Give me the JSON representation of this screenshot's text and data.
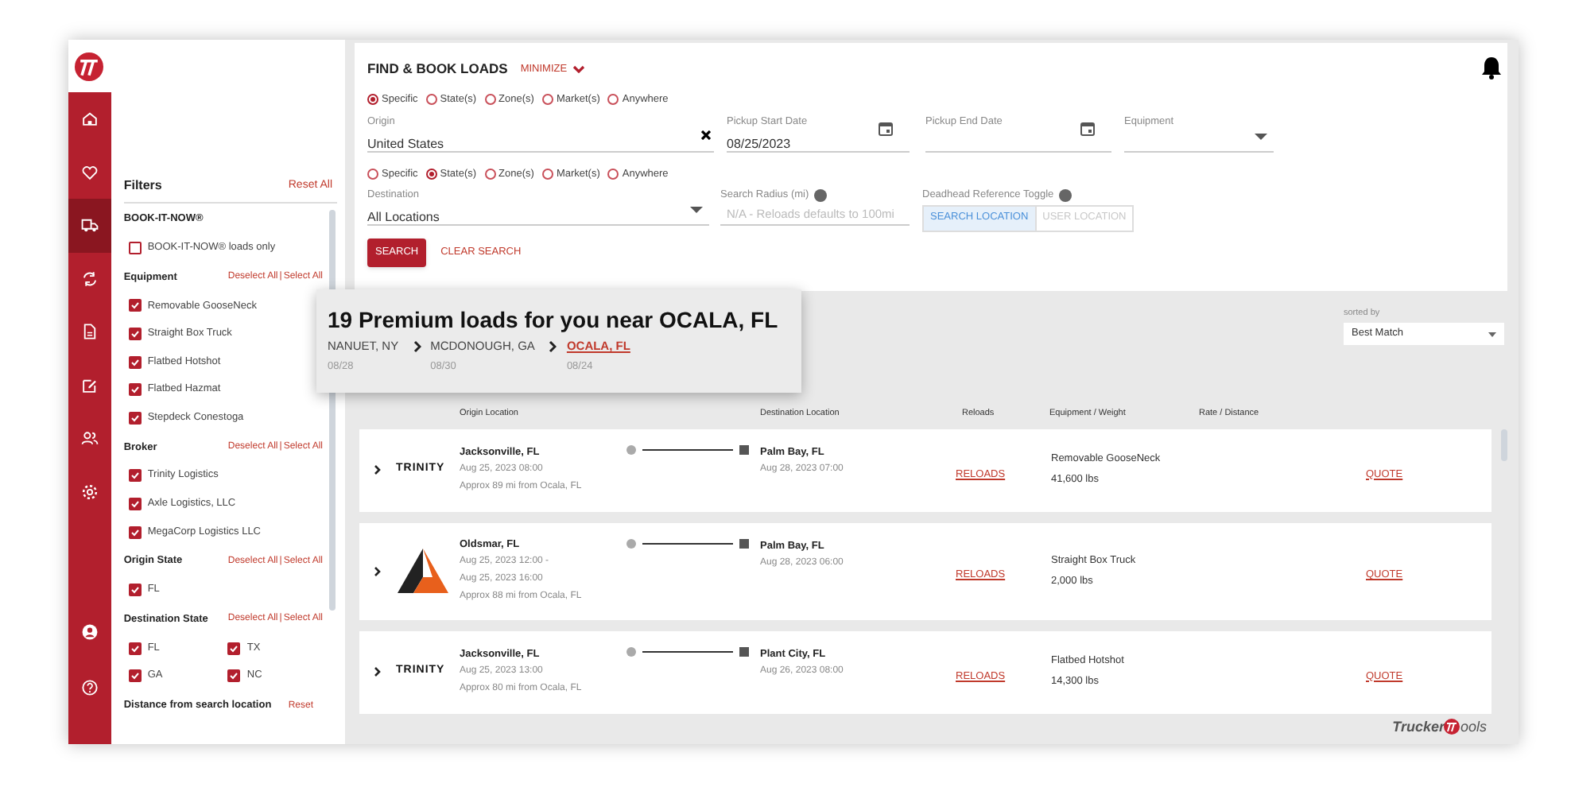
{
  "nav": {
    "items": [
      {
        "kind": "home",
        "selected": false
      },
      {
        "kind": "heart",
        "selected": false
      },
      {
        "kind": "truck",
        "selected": true
      },
      {
        "kind": "refresh",
        "selected": false
      },
      {
        "kind": "document",
        "selected": false
      },
      {
        "kind": "edit",
        "selected": false
      },
      {
        "kind": "users",
        "selected": false
      },
      {
        "kind": "gear",
        "selected": false
      }
    ],
    "bottom_items": [
      {
        "kind": "user",
        "selected": false
      },
      {
        "kind": "help",
        "selected": false
      }
    ]
  },
  "filters": {
    "title": "Filters",
    "reset": "Reset All",
    "sections": [
      {
        "title": "BOOK-IT-NOW®",
        "options": [
          {
            "label": "BOOK-IT-NOW® loads only",
            "checked": false
          }
        ]
      },
      {
        "title": "Equipment",
        "deselect": "Deselect All",
        "separator": "|",
        "select": "Select All",
        "options": [
          {
            "label": "Removable GooseNeck",
            "checked": true
          },
          {
            "label": "Straight Box Truck",
            "checked": true
          },
          {
            "label": "Flatbed Hotshot",
            "checked": true
          },
          {
            "label": "Flatbed Hazmat",
            "checked": true
          },
          {
            "label": "Stepdeck Conestoga",
            "checked": true
          }
        ]
      },
      {
        "title": "Broker",
        "deselect": "Deselect All",
        "separator": "|",
        "select": "Select All",
        "options": [
          {
            "label": "Trinity Logistics",
            "checked": true
          },
          {
            "label": "Axle Logistics, LLC",
            "checked": true
          },
          {
            "label": "MegaCorp Logistics LLC",
            "checked": true
          }
        ]
      },
      {
        "title": "Origin State",
        "deselect": "Deselect All",
        "separator": "|",
        "select": "Select All",
        "options": [
          {
            "label": "FL",
            "checked": true
          }
        ]
      },
      {
        "title": "Destination State",
        "deselect": "Deselect All",
        "separator": "|",
        "select": "Select All",
        "two_columns": true,
        "options": [
          {
            "label": "FL",
            "checked": true
          },
          {
            "label": "TX",
            "checked": true
          },
          {
            "label": "GA",
            "checked": true
          },
          {
            "label": "NC",
            "checked": true
          }
        ]
      },
      {
        "title": "Distance from search location",
        "reset": "Reset"
      }
    ]
  },
  "search": {
    "title": "FIND & BOOK LOADS",
    "minimize": "MINIMIZE",
    "origin_modes": [
      {
        "label": "Specific",
        "selected": true
      },
      {
        "label": "State(s)",
        "selected": false
      },
      {
        "label": "Zone(s)",
        "selected": false
      },
      {
        "label": "Market(s)",
        "selected": false
      },
      {
        "label": "Anywhere",
        "selected": false
      }
    ],
    "origin": {
      "label": "Origin",
      "value": "United States"
    },
    "pickup_start": {
      "label": "Pickup Start Date",
      "value": "08/25/2023"
    },
    "pickup_end": {
      "label": "Pickup End Date"
    },
    "equipment": {
      "label": "Equipment"
    },
    "destination_modes": [
      {
        "label": "Specific",
        "selected": false
      },
      {
        "label": "State(s)",
        "selected": true
      },
      {
        "label": "Zone(s)",
        "selected": false
      },
      {
        "label": "Market(s)",
        "selected": false
      },
      {
        "label": "Anywhere",
        "selected": false
      }
    ],
    "destination": {
      "label": "Destination",
      "value": "All Locations"
    },
    "radius": {
      "label": "Search Radius (mi)",
      "placeholder": "N/A - Reloads defaults to 100mi"
    },
    "deadhead": {
      "label": "Deadhead Reference Toggle",
      "options": [
        {
          "label": "SEARCH LOCATION",
          "selected": true
        },
        {
          "label": "USER LOCATION",
          "selected": false
        }
      ]
    },
    "search_button": "SEARCH",
    "clear_button": "CLEAR SEARCH"
  },
  "sort": {
    "label": "sorted by",
    "value": "Best Match"
  },
  "promo": {
    "title": "19 Premium loads for you near OCALA, FL",
    "stops": [
      {
        "city": "NANUET, NY",
        "date": "08/28",
        "current": false
      },
      {
        "city": "MCDONOUGH, GA",
        "date": "08/30",
        "current": false
      },
      {
        "city": "OCALA, FL",
        "date": "08/24",
        "current": true
      }
    ]
  },
  "columns": [
    "Origin Location",
    "Destination Location",
    "Reloads",
    "Equipment / Weight",
    "Rate / Distance"
  ],
  "loads": [
    {
      "kind": "trinity",
      "logo_text": "TRINITY",
      "origin": "Jacksonville, FL",
      "times": [
        "Aug 25, 2023 08:00"
      ],
      "approx": "Approx 89 mi from Ocala, FL",
      "destination": "Palm Bay, FL",
      "dest_time": "Aug 28, 2023 07:00",
      "reloads": "RELOADS",
      "equipment": "Removable GooseNeck",
      "weight": "41,600 lbs",
      "quote": "QUOTE"
    },
    {
      "kind": "triangle",
      "origin": "Oldsmar, FL",
      "times": [
        "Aug 25, 2023 12:00 -",
        "Aug 25, 2023 16:00"
      ],
      "approx": "Approx 88 mi from Ocala, FL",
      "destination": "Palm Bay, FL",
      "dest_time": "Aug 28, 2023 06:00",
      "reloads": "RELOADS",
      "equipment": "Straight Box Truck",
      "weight": "2,000 lbs",
      "quote": "QUOTE"
    },
    {
      "kind": "trinity",
      "logo_text": "TRINITY",
      "origin": "Jacksonville, FL",
      "times": [
        "Aug 25, 2023 13:00"
      ],
      "approx": "Approx 80 mi from Ocala, FL",
      "destination": "Plant City, FL",
      "dest_time": "Aug 26, 2023 08:00",
      "reloads": "RELOADS",
      "equipment": "Flatbed Hotshot",
      "weight": "14,300 lbs",
      "quote": "QUOTE"
    }
  ],
  "brand": {
    "left": "Trucker",
    "right": "ools"
  }
}
